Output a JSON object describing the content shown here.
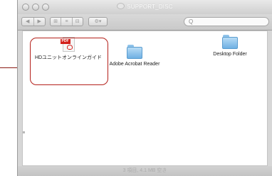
{
  "window": {
    "title": "SUPPORT_DISC",
    "status": "3 項目, 4.1 MB 空き"
  },
  "toolbar": {
    "back_label": "◀",
    "forward_label": "▶",
    "view_icons": "⊞",
    "view_list": "≡",
    "view_columns": "⊟",
    "action_label": "⚙▾",
    "search_placeholder": "",
    "search_icon": "Q"
  },
  "items": [
    {
      "label": "HDユニットオンラインガイド",
      "icon": "pdf-icon",
      "selected_callout": true
    },
    {
      "label": "Adobe Acrobat Reader",
      "icon": "folder-icon"
    },
    {
      "label": "Desktop Folder",
      "icon": "folder-icon"
    }
  ],
  "pdf_badge": "PDF",
  "colors": {
    "callout": "#b4201a",
    "folder": "#6fb0e3"
  }
}
